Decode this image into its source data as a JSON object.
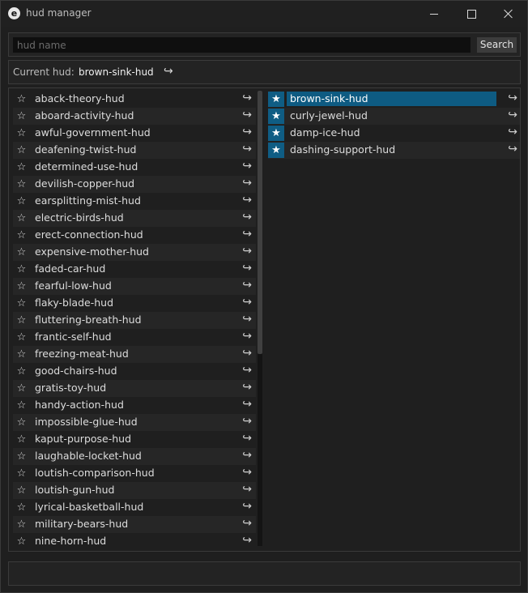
{
  "window": {
    "title": "hud manager",
    "app_icon_glyph": "e"
  },
  "search": {
    "placeholder": "hud name",
    "value": "",
    "button_label": "Search"
  },
  "current": {
    "label": "Current hud:",
    "value": "brown-sink-hud",
    "load_glyph": "↪"
  },
  "icons": {
    "star_outline": "☆",
    "star_filled": "★",
    "load": "↪"
  },
  "colors": {
    "accent": "#0e5b82",
    "background": "#1f1f1f"
  },
  "all_huds": [
    "aback-theory-hud",
    "aboard-activity-hud",
    "awful-government-hud",
    "deafening-twist-hud",
    "determined-use-hud",
    "devilish-copper-hud",
    "earsplitting-mist-hud",
    "electric-birds-hud",
    "erect-connection-hud",
    "expensive-mother-hud",
    "faded-car-hud",
    "fearful-low-hud",
    "flaky-blade-hud",
    "fluttering-breath-hud",
    "frantic-self-hud",
    "freezing-meat-hud",
    "good-chairs-hud",
    "gratis-toy-hud",
    "handy-action-hud",
    "impossible-glue-hud",
    "kaput-purpose-hud",
    "laughable-locket-hud",
    "loutish-comparison-hud",
    "loutish-gun-hud",
    "lyrical-basketball-hud",
    "military-bears-hud",
    "nine-horn-hud"
  ],
  "favorite_huds": [
    "brown-sink-hud",
    "curly-jewel-hud",
    "damp-ice-hud",
    "dashing-support-hud"
  ],
  "selected_favorite": "brown-sink-hud"
}
